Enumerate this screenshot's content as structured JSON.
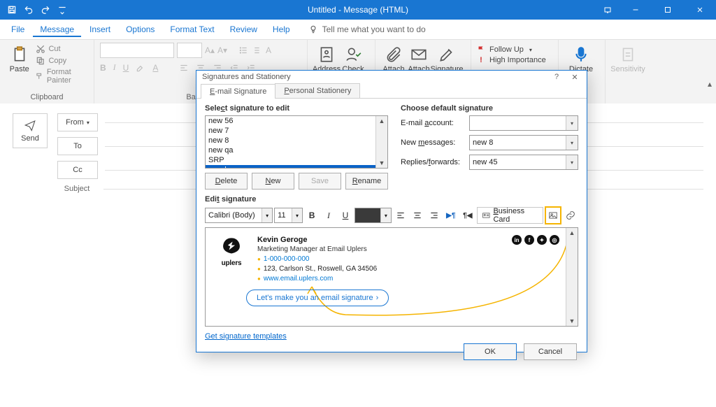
{
  "window": {
    "title": "Untitled  -  Message (HTML)"
  },
  "menu": {
    "file": "File",
    "message": "Message",
    "insert": "Insert",
    "options": "Options",
    "format_text": "Format Text",
    "review": "Review",
    "help": "Help",
    "tell_me": "Tell me what you want to do"
  },
  "ribbon": {
    "paste": "Paste",
    "cut": "Cut",
    "copy": "Copy",
    "format_painter": "Format Painter",
    "clipboard_group": "Clipboard",
    "basic_text_group": "Basic Te",
    "address": "Address",
    "check": "Check",
    "attach_file": "Attach",
    "attach_item": "Attach",
    "signature": "Signature",
    "follow_up": "Follow Up",
    "high_importance": "High Importance",
    "dictate": "Dictate",
    "sensitivity": "Sensitivity"
  },
  "compose": {
    "send": "Send",
    "from": "From",
    "to": "To",
    "cc": "Cc",
    "subject": "Subject"
  },
  "dialog": {
    "title": "Signatures and Stationery",
    "tab_email": "E-mail Signature",
    "tab_stationery": "Personal Stationery",
    "select_label": "Select signature to edit",
    "items": [
      "new 56",
      "new 7",
      "new 8",
      "new qa",
      "SRP",
      "yuval"
    ],
    "btn_delete": "Delete",
    "btn_new": "New",
    "btn_save": "Save",
    "btn_rename": "Rename",
    "default_label": "Choose default signature",
    "email_account_lbl": "E-mail account:",
    "email_account_val": "",
    "new_msg_lbl": "New messages:",
    "new_msg_val": "new 8",
    "replies_lbl": "Replies/forwards:",
    "replies_val": "new 45",
    "edit_label": "Edit signature",
    "font_name": "Calibri (Body)",
    "font_size": "11",
    "business_card": "Business Card",
    "tmpl_link": "Get signature templates",
    "ok": "OK",
    "cancel": "Cancel"
  },
  "signature": {
    "logo_text": "uplers",
    "name": "Kevin Geroge",
    "role": "Marketing Manager at Email Uplers",
    "phone": "1-000-000-000",
    "address": "123, Carlson St., Roswell, GA 34506",
    "site": "www.email.uplers.com",
    "cta": "Let's make you an email signature"
  }
}
